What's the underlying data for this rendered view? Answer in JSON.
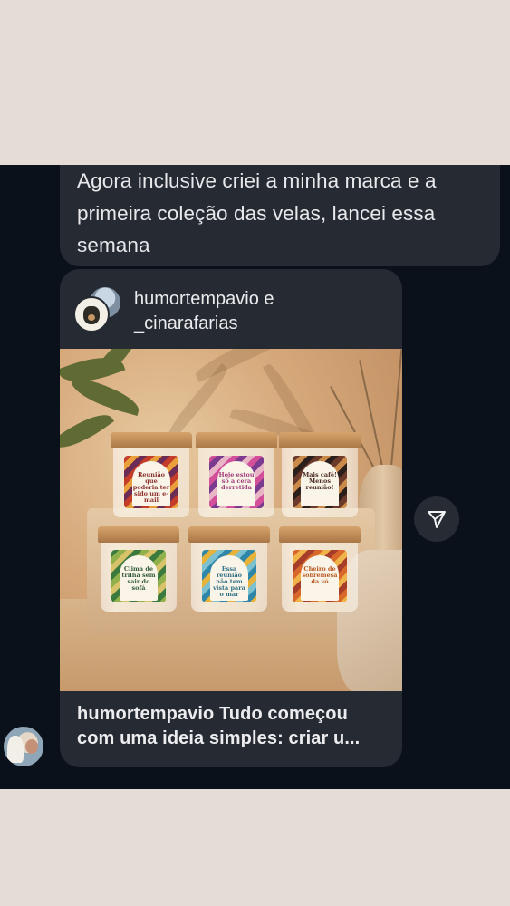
{
  "message": {
    "text": "Agora inclusive criei a minha marca e a primeira coleção das velas, lancei essa semana"
  },
  "shared_post": {
    "author_line1": "humortempavio e",
    "author_line2": "_cinarafarias",
    "caption_line1": "humortempavio Tudo começou",
    "caption_line2": "com uma ideia simples: criar u...",
    "candles": [
      {
        "label": "Reunião que poderia ter sido um e-mail",
        "color": "#8c2f2a"
      },
      {
        "label": "Hoje estou só a cera derretida",
        "color": "#a23a7a"
      },
      {
        "label": "Mais café! Menos reunião!",
        "color": "#4a2a22"
      },
      {
        "label": "Clima de trilha sem sair do sofá",
        "color": "#2f5a3a"
      },
      {
        "label": "Essa reunião não tem vista para o mar",
        "color": "#2e6f86"
      },
      {
        "label": "Cheiro de sobremesa da vó",
        "color": "#b8561f"
      }
    ],
    "candle_palettes": [
      [
        "#c43d2b",
        "#e9a03b",
        "#6a2b54"
      ],
      [
        "#d44f9a",
        "#7a3b8f",
        "#e8b5c6"
      ],
      [
        "#6b3a2a",
        "#c98a4a",
        "#2a1f1b"
      ],
      [
        "#3b7a3f",
        "#8fb04a",
        "#d8c26a"
      ],
      [
        "#2f86a8",
        "#e6b23a",
        "#7dc1d1"
      ],
      [
        "#d8672a",
        "#f0b34a",
        "#a63c2a"
      ]
    ]
  },
  "icons": {
    "share": "send-arrow-icon",
    "colors": {
      "chat_bg": "#0b111a",
      "bubble_bg": "#252a33",
      "text": "#e9e9ec"
    }
  }
}
